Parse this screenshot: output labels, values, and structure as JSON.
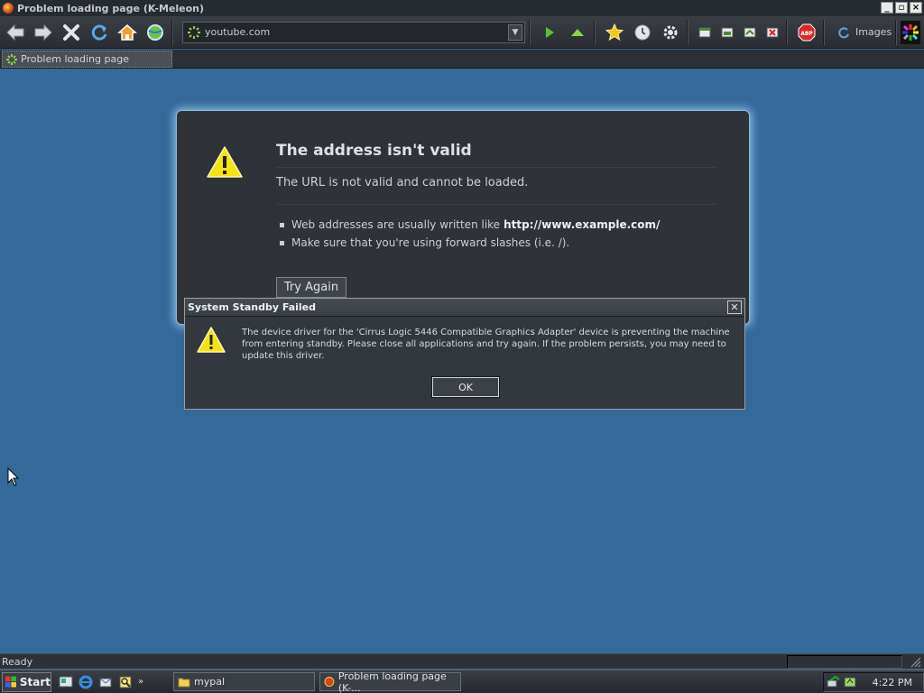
{
  "window": {
    "title": "Problem loading page (K-Meleon)",
    "minimize": "_",
    "maximize": "▫",
    "close": "×"
  },
  "toolbar": {
    "url": "youtube.com",
    "images_label": "Images"
  },
  "tabs": [
    {
      "label": "Problem loading page"
    }
  ],
  "error_page": {
    "title": "The address isn't valid",
    "description": "The URL is not valid and cannot be loaded.",
    "bullets": [
      {
        "text": "Web addresses are usually written like",
        "bold": "http://www.example.com/"
      },
      {
        "text": "Make sure that you're using forward slashes (i.e. /).",
        "bold": ""
      }
    ],
    "try_again": "Try Again"
  },
  "dialog": {
    "title": "System Standby Failed",
    "message": "The device driver for the 'Cirrus Logic 5446 Compatible Graphics Adapter' device is preventing the machine from entering standby. Please close all applications and try again. If the problem persists, you may need to update this driver.",
    "ok_label": "OK"
  },
  "statusbar": {
    "text": "Ready"
  },
  "taskbar": {
    "start_label": "Start",
    "tasks": [
      {
        "label": "mypal"
      },
      {
        "label": "Problem loading page (K-..."
      }
    ],
    "clock": "4:22 PM"
  },
  "colors": {
    "desktop": "#34699a",
    "chrome": "#2f3338",
    "glow": "#8ec2ea"
  }
}
